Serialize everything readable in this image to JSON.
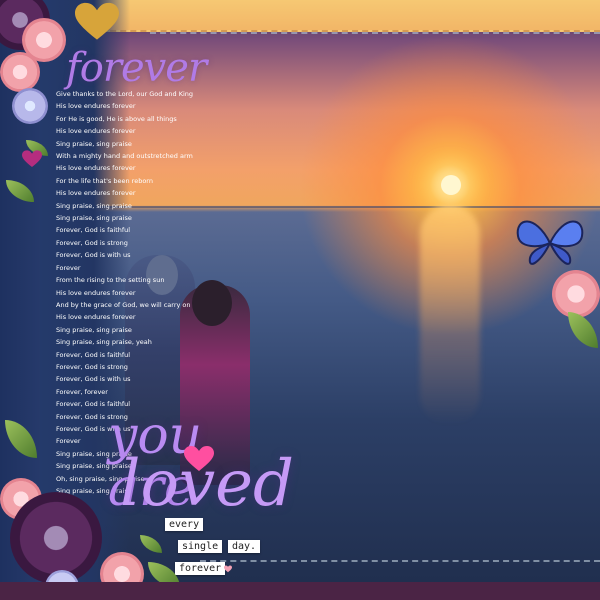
{
  "title": "forever",
  "lyrics": [
    "Give thanks to the Lord, our God and King",
    "His love endures forever",
    "For He is good, He is above all things",
    "His love endures forever",
    "Sing praise, sing praise",
    "With a mighty hand and outstretched arm",
    "His love endures forever",
    "For the life that's been reborn",
    "His love endures forever",
    "Sing praise, sing praise",
    "Sing praise, sing praise",
    "Forever, God is faithful",
    "Forever, God is strong",
    "Forever, God is with us",
    "Forever",
    "From the rising to the setting sun",
    "His love endures forever",
    "And by the grace of God, we will carry on",
    "His love endures forever",
    "Sing praise, sing praise",
    "Sing praise, sing praise, yeah",
    "Forever, God is faithful",
    "Forever, God is strong",
    "Forever, God is with us",
    "Forever, forever",
    "Forever, God is faithful",
    "Forever, God is strong",
    "Forever, God is with us",
    "Forever",
    "Sing praise, sing praise",
    "Sing praise, sing praise",
    "Oh, sing praise, sing praise",
    "Sing praise, sing praise"
  ],
  "headline": {
    "line1": "you are",
    "line2": "loved"
  },
  "labels": {
    "every": "every",
    "single": "single",
    "day": "day.",
    "forever": "forever"
  },
  "colors": {
    "sun": "#fff7d0",
    "title_purple": "#b07be6",
    "heart_pink": "#ff4fa0",
    "paper_navy": "#233663",
    "paper_yellow": "#f2b667"
  }
}
